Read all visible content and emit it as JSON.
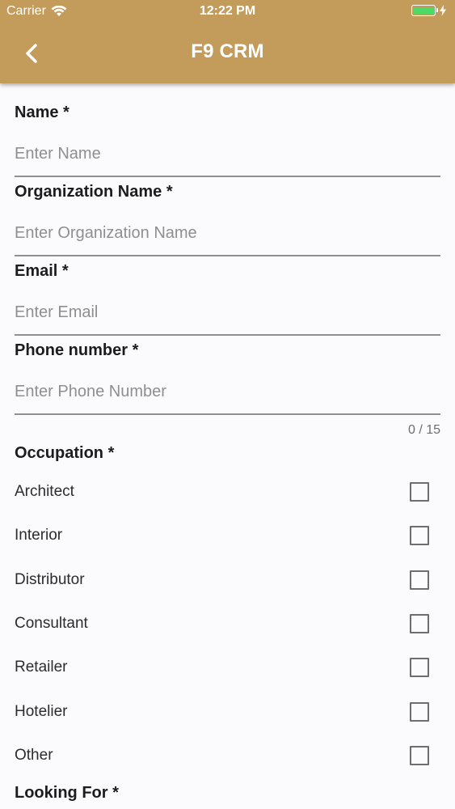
{
  "status_bar": {
    "carrier": "Carrier",
    "time": "12:22 PM"
  },
  "header": {
    "title": "F9 CRM"
  },
  "form": {
    "name": {
      "label": "Name *",
      "placeholder": "Enter Name"
    },
    "organization": {
      "label": "Organization Name *",
      "placeholder": "Enter Organization Name"
    },
    "email": {
      "label": "Email *",
      "placeholder": "Enter Email"
    },
    "phone": {
      "label": "Phone number *",
      "placeholder": "Enter Phone Number",
      "counter": "0 / 15"
    },
    "occupation": {
      "label": "Occupation *",
      "options": [
        "Architect",
        "Interior",
        "Distributor",
        "Consultant",
        "Retailer",
        "Hotelier",
        "Other"
      ]
    },
    "looking_for": {
      "label": "Looking For *"
    }
  },
  "colors": {
    "appbar": "#c39c5c",
    "battery": "#4cd964",
    "background": "#fbfafc"
  }
}
